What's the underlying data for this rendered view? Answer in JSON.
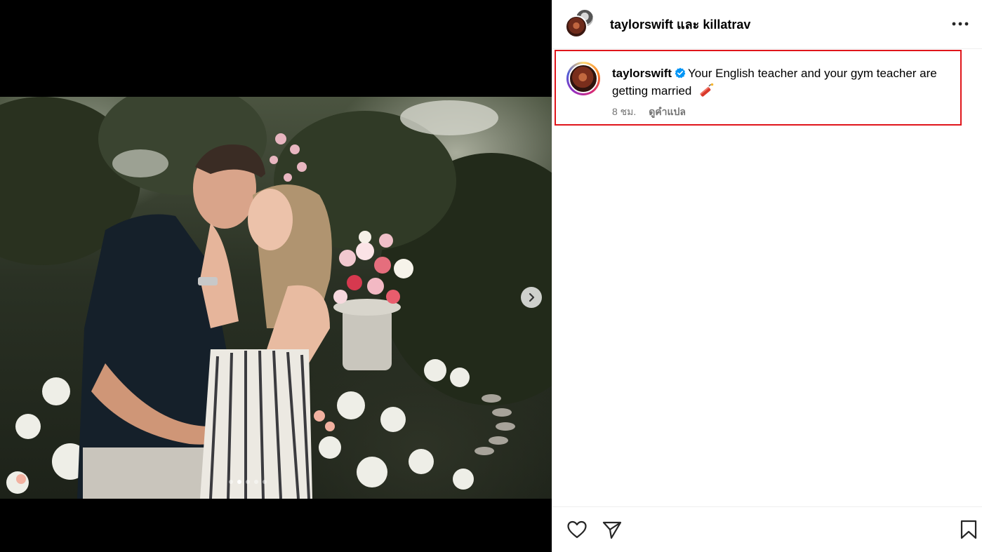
{
  "header": {
    "title": "taylorswift และ killatrav",
    "more_icon": "more-horizontal-icon"
  },
  "caption": {
    "username": "taylorswift",
    "verified_icon": "verified-badge-icon",
    "text": "Your English teacher and your gym teacher are getting married",
    "emoji_icon": "dynamite-emoji-icon",
    "time": "8 ชม.",
    "translate_label": "ดูคำแปล"
  },
  "media": {
    "next_icon": "chevron-right-icon",
    "slide_count": 5,
    "active_slide": 2
  },
  "actions": {
    "like_icon": "heart-icon",
    "share_icon": "paper-plane-icon",
    "save_icon": "bookmark-icon"
  },
  "colors": {
    "highlight_border": "#e0151b",
    "verified_blue": "#0095f6",
    "meta_gray": "#737373"
  }
}
